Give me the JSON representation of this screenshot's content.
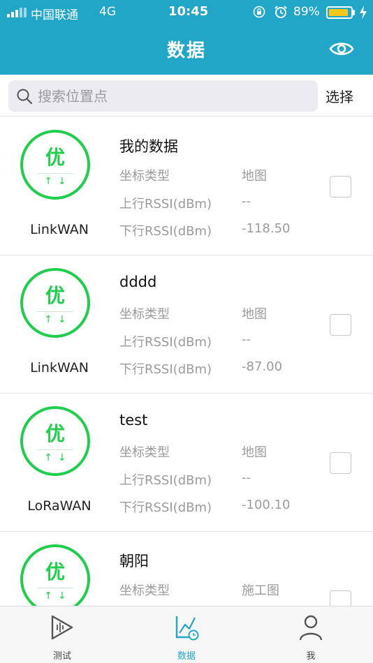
{
  "status": {
    "carrier": "中国联通",
    "network": "4G",
    "time": "10:45",
    "battery_percent": 89,
    "battery_label": "89%",
    "icons": [
      "signal-icon",
      "lock-rotation-icon",
      "alarm-icon",
      "battery-icon",
      "charging-bolt-icon"
    ]
  },
  "header": {
    "title": "数据",
    "action_icon": "eye-icon"
  },
  "search": {
    "placeholder": "搜索位置点",
    "value": "",
    "select_label": "选择"
  },
  "colors": {
    "primary": "#22a6c8",
    "grade_green": "#1fce4d",
    "battery_yellow": "#f7c81b"
  },
  "items": [
    {
      "name": "我的数据",
      "grade": "优",
      "arrows": "↑↓",
      "protocol": "LinkWAN",
      "coord_label": "坐标类型",
      "coord_value": "地图",
      "up_label": "上行RSSI(dBm)",
      "up_value": "--",
      "down_label": "下行RSSI(dBm)",
      "down_value": "-118.50"
    },
    {
      "name": "dddd",
      "grade": "优",
      "arrows": "↑↓",
      "protocol": "LinkWAN",
      "coord_label": "坐标类型",
      "coord_value": "地图",
      "up_label": "上行RSSI(dBm)",
      "up_value": "--",
      "down_label": "下行RSSI(dBm)",
      "down_value": "-87.00"
    },
    {
      "name": "test",
      "grade": "优",
      "arrows": "↑↓",
      "protocol": "LoRaWAN",
      "coord_label": "坐标类型",
      "coord_value": "地图",
      "up_label": "上行RSSI(dBm)",
      "up_value": "--",
      "down_label": "下行RSSI(dBm)",
      "down_value": "-100.10"
    },
    {
      "name": "朝阳",
      "grade": "优",
      "arrows": "↑↓",
      "protocol": "",
      "coord_label": "坐标类型",
      "coord_value": "施工图",
      "up_label": "",
      "up_value": "",
      "down_label": "",
      "down_value": ""
    }
  ],
  "tabs": [
    {
      "label": "测试",
      "icon": "play-test-icon",
      "active": false
    },
    {
      "label": "数据",
      "icon": "chart-clock-icon",
      "active": true
    },
    {
      "label": "我",
      "icon": "person-icon",
      "active": false
    }
  ]
}
